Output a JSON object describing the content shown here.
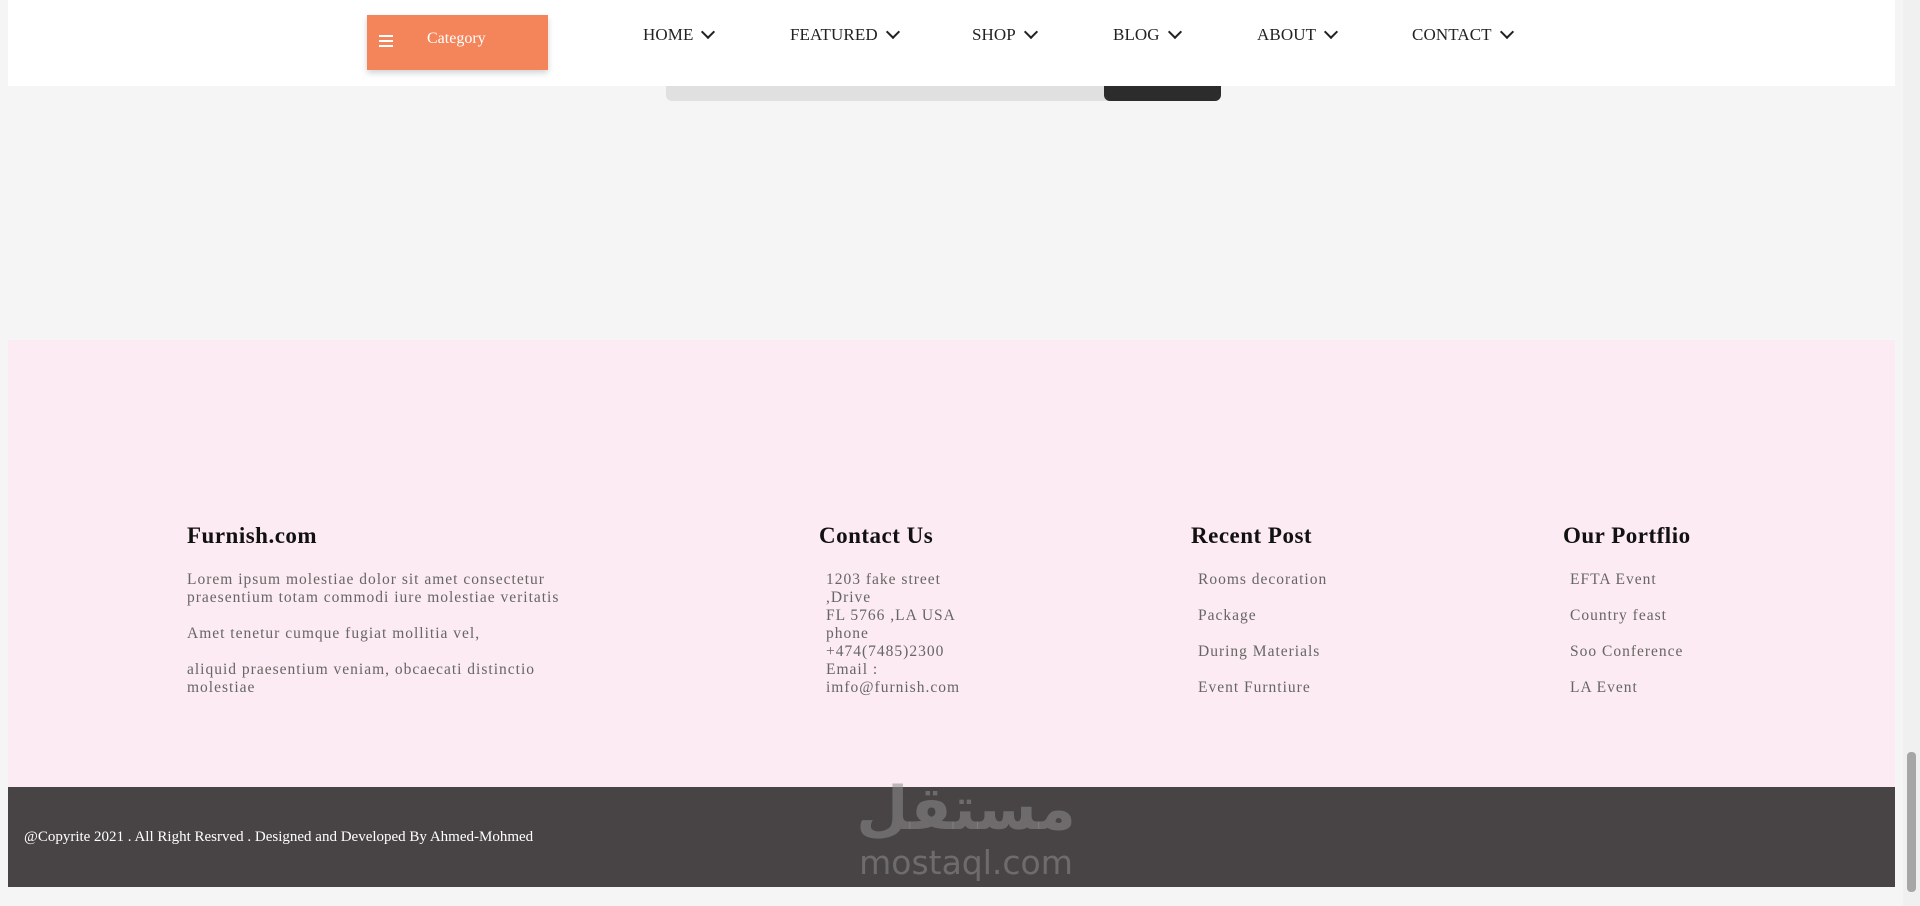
{
  "header": {
    "category_label": "Category",
    "menu_icon": "hamburger-icon",
    "nav": [
      {
        "label": "HOME"
      },
      {
        "label": "FEATURED"
      },
      {
        "label": "SHOP"
      },
      {
        "label": "BLOG"
      },
      {
        "label": "ABOUT"
      },
      {
        "label": "CONTACT"
      }
    ],
    "accent_color": "#f4845a"
  },
  "footer": {
    "about": {
      "title": "Furnish.com",
      "p1": "Lorem ipsum molestiae dolor sit amet consectetur praesentium totam commodi iure molestiae veritatis",
      "p2": "Amet tenetur cumque fugiat mollitia vel,",
      "p3": "aliquid praesentium veniam, obcaecati distinctio molestiae"
    },
    "contact": {
      "title": "Contact Us",
      "lines": [
        "1203 fake street",
        ",Drive",
        "FL 5766 ,LA USA",
        "phone",
        "+474(7485)2300",
        "Email :",
        "imfo@furnish.com"
      ]
    },
    "recent": {
      "title": "Recent Post",
      "items": [
        "Rooms decoration",
        "Package",
        "During Materials",
        "Event Furntiure"
      ]
    },
    "portfolio": {
      "title": "Our Portflio",
      "items": [
        "EFTA Event",
        "Country feast",
        "Soo Conference",
        "LA Event"
      ]
    },
    "background": "#fcebf2"
  },
  "copyright": {
    "text": "@Copyrite 2021 . All Right Resrved . Designed and Developed By Ahmed-Mohmed",
    "background": "#484445"
  },
  "watermark": {
    "arabic": "مستقل",
    "latin": "mostaql.com"
  }
}
